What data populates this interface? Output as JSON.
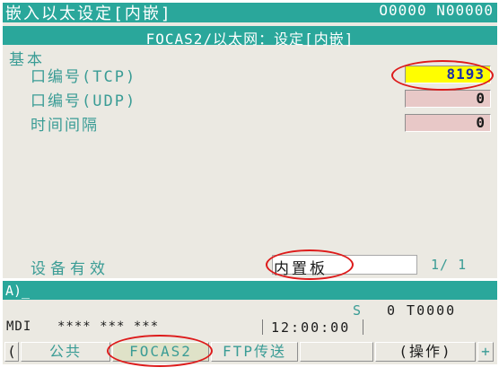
{
  "header": {
    "title": "嵌入以太设定[内嵌]",
    "program_numbers": "O0000 N00000"
  },
  "subheader": {
    "title": "FOCAS2/以太网：设定[内嵌]"
  },
  "section": {
    "label": "基本"
  },
  "params": [
    {
      "label": "口编号(TCP)",
      "value": "8193"
    },
    {
      "label": "口编号(UDP)",
      "value": "0"
    },
    {
      "label": "时间间隔",
      "value": "0"
    }
  ],
  "device": {
    "label": "设备有效",
    "value": "内置板"
  },
  "page_indicator": "1/ 1",
  "input_line": {
    "prompt": "A)_"
  },
  "status": {
    "s_label": "S",
    "s_value": "0 T0000",
    "mode": "MDI",
    "state": "**** *** ***",
    "time": "12:00:00"
  },
  "softkeys": {
    "prev": "(",
    "common": "公共",
    "focas2": "FOCAS2",
    "ftp": "FTP传送",
    "blank": "",
    "operation": "(操作)",
    "next": "+"
  },
  "colors": {
    "title_bg": "#2aa79b",
    "panel_bg": "#ebe9e2",
    "label_text": "#3a9c95",
    "highlight_field": "#fffe00",
    "field_bg": "#e8c8c7",
    "annotation": "#dd1b1b"
  }
}
